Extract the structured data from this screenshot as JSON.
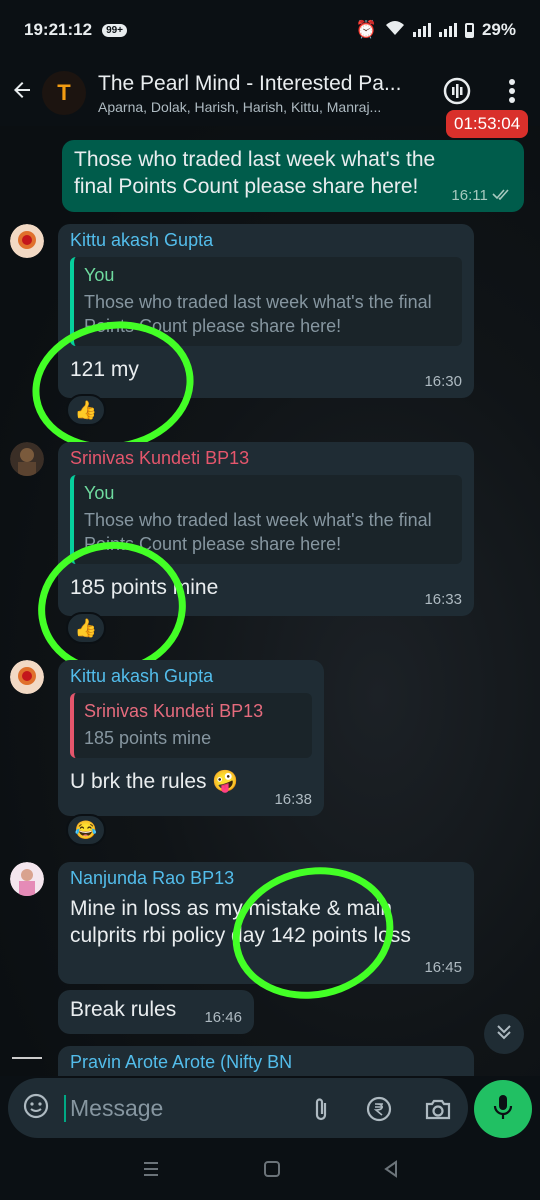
{
  "status_bar": {
    "time": "19:21:12",
    "notif_count": "99+",
    "battery": "29%"
  },
  "header": {
    "title": "The Pearl Mind - Interested Pa...",
    "subtitle": "Aparna, Dolak, Harish, Harish, Kittu, Manraj...",
    "avatar_text": "T",
    "call_timer": "01:53:04"
  },
  "messages": {
    "m1": {
      "text": "Those who traded last week what's the final Points Count please share here!",
      "time": "16:11"
    },
    "m2": {
      "sender": "Kittu akash Gupta",
      "quote_author": "You",
      "quote_text": "Those who traded last week what's the final Points Count please share here!",
      "text": "121 my",
      "time": "16:30",
      "reaction": "👍"
    },
    "m3": {
      "sender": "Srinivas Kundeti BP13",
      "quote_author": "You",
      "quote_text": "Those who traded last week what's the final Points Count please share here!",
      "text": "185 points  mine",
      "time": "16:33",
      "reaction": "👍"
    },
    "m4": {
      "sender": "Kittu akash Gupta",
      "quote_author": "Srinivas Kundeti BP13",
      "quote_text": "185 points  mine",
      "text": "U brk the rules 🤪",
      "time": "16:38",
      "reaction": "😂"
    },
    "m5": {
      "sender": "Nanjunda Rao BP13",
      "text": "Mine in loss as my mistake  & main culprits  rbi policy day 142 points  loss",
      "time": "16:45"
    },
    "m6": {
      "text": "Break rules",
      "time": "16:46"
    },
    "m7": {
      "sender": "Pravin Arote Arote (Nifty BN"
    }
  },
  "input": {
    "placeholder": "Message"
  },
  "colors": {
    "accent": "#00a884",
    "outgoing_bubble": "#005c4b",
    "incoming_bubble": "#1f2c34",
    "highlight_circle": "#43ff26",
    "timer_red": "#d9302b"
  },
  "icons": [
    "back-arrow-icon",
    "voice-chat-icon",
    "more-vert-icon",
    "double-check-icon",
    "sticker-icon",
    "attach-icon",
    "rupee-icon",
    "camera-icon",
    "mic-icon",
    "chevron-double-down-icon"
  ]
}
